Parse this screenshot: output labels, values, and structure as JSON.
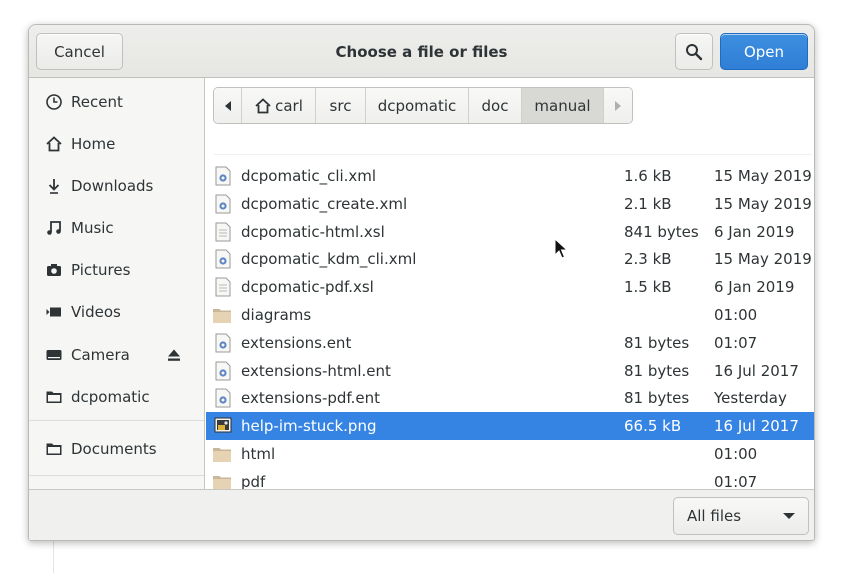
{
  "dialog": {
    "title": "Choose a file or files",
    "cancel_label": "Cancel",
    "open_label": "Open",
    "accent_color": "#3584e4"
  },
  "sidebar": {
    "items": [
      {
        "label": "Recent",
        "icon": "clock-icon"
      },
      {
        "label": "Home",
        "icon": "home-icon"
      },
      {
        "label": "Downloads",
        "icon": "download-icon"
      },
      {
        "label": "Music",
        "icon": "music-icon"
      },
      {
        "label": "Pictures",
        "icon": "camera-icon"
      },
      {
        "label": "Videos",
        "icon": "video-icon"
      },
      {
        "label": "Camera",
        "icon": "drive-icon"
      },
      {
        "label": "dcpomatic",
        "icon": "folder-icon"
      },
      {
        "label": "Documents",
        "icon": "folder-icon"
      }
    ]
  },
  "pathbar": {
    "crumbs": [
      "carl",
      "src",
      "dcpomatic",
      "doc",
      "manual"
    ]
  },
  "files": [
    {
      "name": "dcpomatic_cli.xml",
      "size": "1.6 kB",
      "date": "15 May 2019",
      "type": "xml"
    },
    {
      "name": "dcpomatic_create.xml",
      "size": "2.1 kB",
      "date": "15 May 2019",
      "type": "xml"
    },
    {
      "name": "dcpomatic-html.xsl",
      "size": "841 bytes",
      "date": "6 Jan 2019",
      "type": "text"
    },
    {
      "name": "dcpomatic_kdm_cli.xml",
      "size": "2.3 kB",
      "date": "15 May 2019",
      "type": "xml"
    },
    {
      "name": "dcpomatic-pdf.xsl",
      "size": "1.5 kB",
      "date": "6 Jan 2019",
      "type": "text"
    },
    {
      "name": "diagrams",
      "size": "",
      "date": "01:00",
      "type": "folder"
    },
    {
      "name": "extensions.ent",
      "size": "81 bytes",
      "date": "01:07",
      "type": "xml"
    },
    {
      "name": "extensions-html.ent",
      "size": "81 bytes",
      "date": "16 Jul 2017",
      "type": "xml"
    },
    {
      "name": "extensions-pdf.ent",
      "size": "81 bytes",
      "date": "Yesterday",
      "type": "xml"
    },
    {
      "name": "help-im-stuck.png",
      "size": "66.5 kB",
      "date": "16 Jul 2017",
      "type": "image",
      "selected": true
    },
    {
      "name": "html",
      "size": "",
      "date": "01:00",
      "type": "folder"
    },
    {
      "name": "pdf",
      "size": "",
      "date": "01:07",
      "type": "folder"
    }
  ],
  "footer": {
    "filter_label": "All files"
  }
}
